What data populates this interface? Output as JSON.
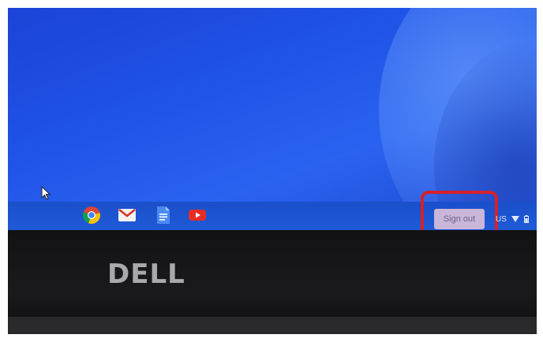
{
  "shelf": {
    "apps": [
      {
        "name": "chrome-icon"
      },
      {
        "name": "gmail-icon"
      },
      {
        "name": "docs-icon"
      },
      {
        "name": "youtube-icon"
      }
    ],
    "signout_label": "Sign out",
    "status": {
      "locale": "US",
      "icons": [
        "wifi-icon",
        "battery-icon"
      ]
    }
  },
  "bezel": {
    "logo_text": "DELL"
  },
  "colors": {
    "wallpaper": "#1f52e6",
    "shelf": "#1f5ad7",
    "signout_button": "#c9b6d9",
    "highlight": "#d6202a",
    "bezel": "#121214"
  }
}
